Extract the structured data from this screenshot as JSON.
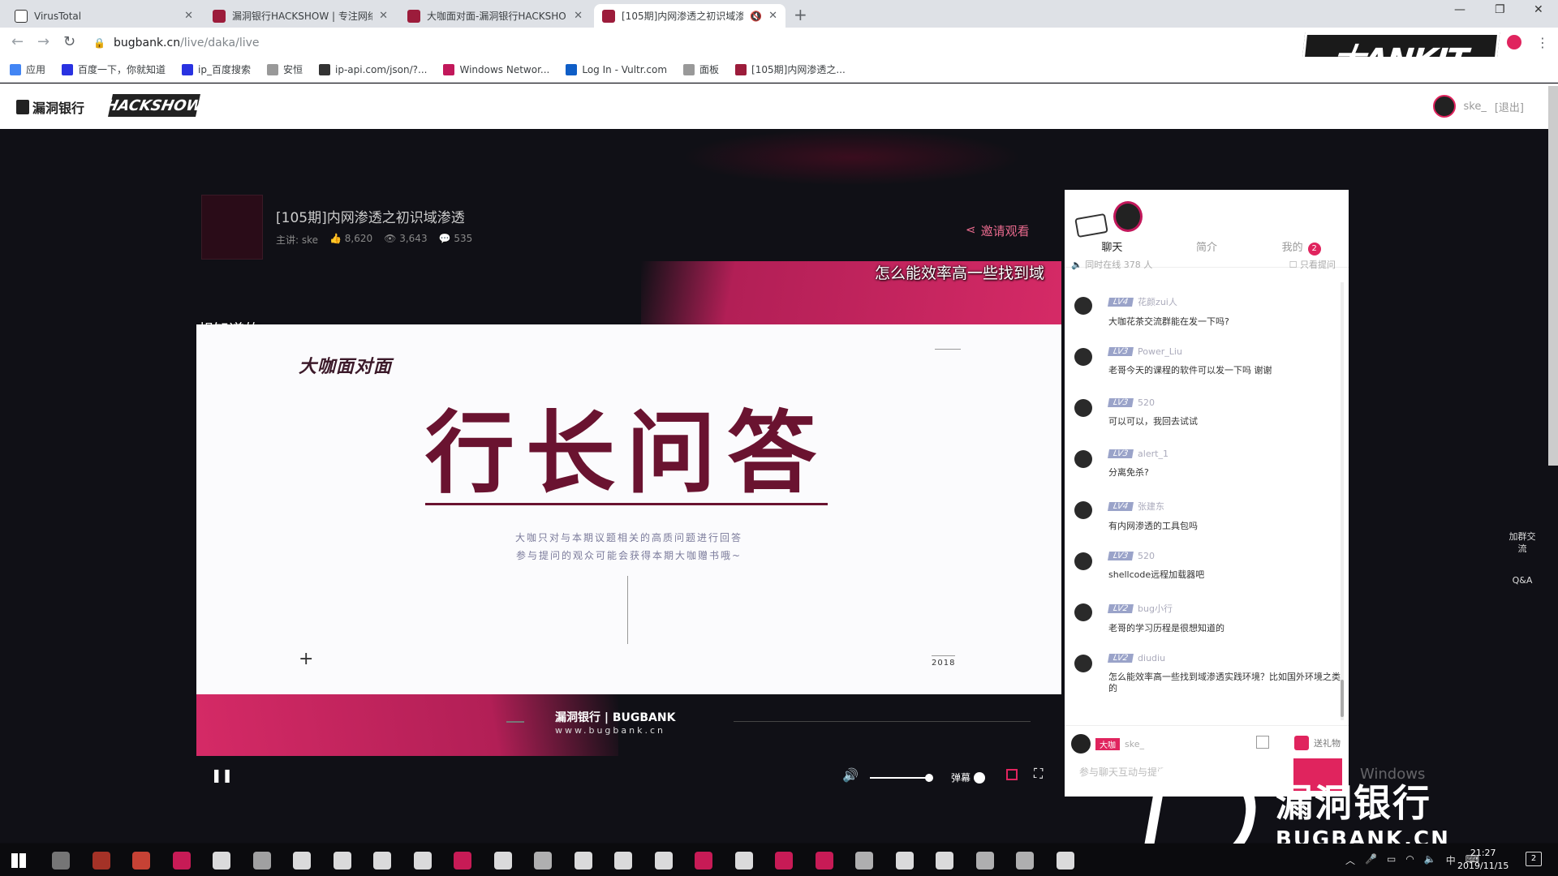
{
  "browser": {
    "tabs": [
      {
        "title": "VirusTotal",
        "fav": "#ffffff"
      },
      {
        "title": "漏洞银行HACKSHOW | 专注网络",
        "fav": "#9c1c3b"
      },
      {
        "title": "大咖面对面-漏洞银行HACKSHO",
        "fav": "#9c1c3b"
      },
      {
        "title": "[105期]内网渗透之初识域渗",
        "fav": "#9c1c3b"
      }
    ],
    "url_host": "bugbank.cn",
    "url_path": "/live/daka/live",
    "bookmarks": [
      {
        "label": "应用",
        "color": "#4285f4"
      },
      {
        "label": "百度一下，你就知道",
        "color": "#2932e1"
      },
      {
        "label": "ip_百度搜索",
        "color": "#2932e1"
      },
      {
        "label": "安恒",
        "color": "#999999"
      },
      {
        "label": "ip-api.com/json/?...",
        "color": "#333333"
      },
      {
        "label": "Windows Networ...",
        "color": "#c2185b"
      },
      {
        "label": "Log In - Vultr.com",
        "color": "#0f5ec7"
      },
      {
        "label": "面板",
        "color": "#999999"
      },
      {
        "label": "[105期]内网渗透之...",
        "color": "#9c1c3b"
      }
    ],
    "top_watermark": "大ANKIT"
  },
  "site": {
    "logo_text": "漏洞银行",
    "hackshow": "HACKSHOW",
    "username": "ske_",
    "logout": "[退出]"
  },
  "course": {
    "title": "[105期]内网渗透之初识域渗透",
    "speaker": "主讲:  ske",
    "likes": "8,620",
    "views": "3,643",
    "comments": "535",
    "invite": "邀请观看"
  },
  "danmu": [
    "怎么能效率高一些找到域",
    "想知道的"
  ],
  "slide": {
    "logo": "大咖面对面",
    "headline": "行长问答",
    "desc1": "大咖只对与本期议题相关的高质问题进行回答",
    "desc2": "参与提问的观众可能会获得本期大咖赠书哦~",
    "year": "2018",
    "plus": "+"
  },
  "bugbank_brand": {
    "name": "漏洞银行 | BUGBANK",
    "url": "www.bugbank.cn"
  },
  "player": {
    "danmu_label": "弹幕"
  },
  "chat": {
    "tabs": [
      "聊天",
      "简介",
      "我的"
    ],
    "my_badge": "2",
    "online_label": "同时在线  378  人",
    "question_only": "只看提问",
    "messages": [
      {
        "level": "LV4",
        "user": "花颜zui人",
        "text": "大咖花茶交流群能在发一下吗?"
      },
      {
        "level": "LV3",
        "user": "Power_Liu",
        "text": "老哥今天的课程的软件可以发一下吗 谢谢"
      },
      {
        "level": "LV3",
        "user": "520",
        "text": "可以可以，我回去试试"
      },
      {
        "level": "LV3",
        "user": "alert_1",
        "text": "分离免杀?"
      },
      {
        "level": "LV4",
        "user": "张建东",
        "text": "有内网渗透的工具包吗"
      },
      {
        "level": "LV3",
        "user": "520",
        "text": "shellcode远程加载器吧"
      },
      {
        "level": "LV2",
        "user": "bug小行",
        "text": "老哥的学习历程是很想知道的"
      },
      {
        "level": "LV2",
        "user": "diudiu",
        "text": "怎么能效率高一些找到域渗透实践环境？比如国外环境之类的"
      }
    ],
    "me_tag": "大咖",
    "me_name": "ske_",
    "gift": "送礼物",
    "input_placeholder": "参与聊天互动与提问"
  },
  "side_float": {
    "join": "加群交流",
    "qa": "Q&A"
  },
  "watermark": {
    "cn": "漏洞银行",
    "en": "BUGBANK.CN",
    "activate": "Windows"
  },
  "taskbar": {
    "time": "21:27",
    "date": "2019/11/15",
    "ime": "中",
    "notif_count": "2",
    "icon_colors": [
      "#888888",
      "#c0392b",
      "#e74c3c",
      "#e91e63",
      "#ffffff",
      "#bbbbbb",
      "#ffffff",
      "#ffffff",
      "#ffffff",
      "#ffffff",
      "#e91e63",
      "#ffffff",
      "#cccccc",
      "#ffffff",
      "#ffffff",
      "#ffffff",
      "#e91e63",
      "#ffffff",
      "#e91e63",
      "#e91e63",
      "#cccccc",
      "#ffffff",
      "#ffffff",
      "#cccccc",
      "#cccccc",
      "#ffffff"
    ]
  }
}
